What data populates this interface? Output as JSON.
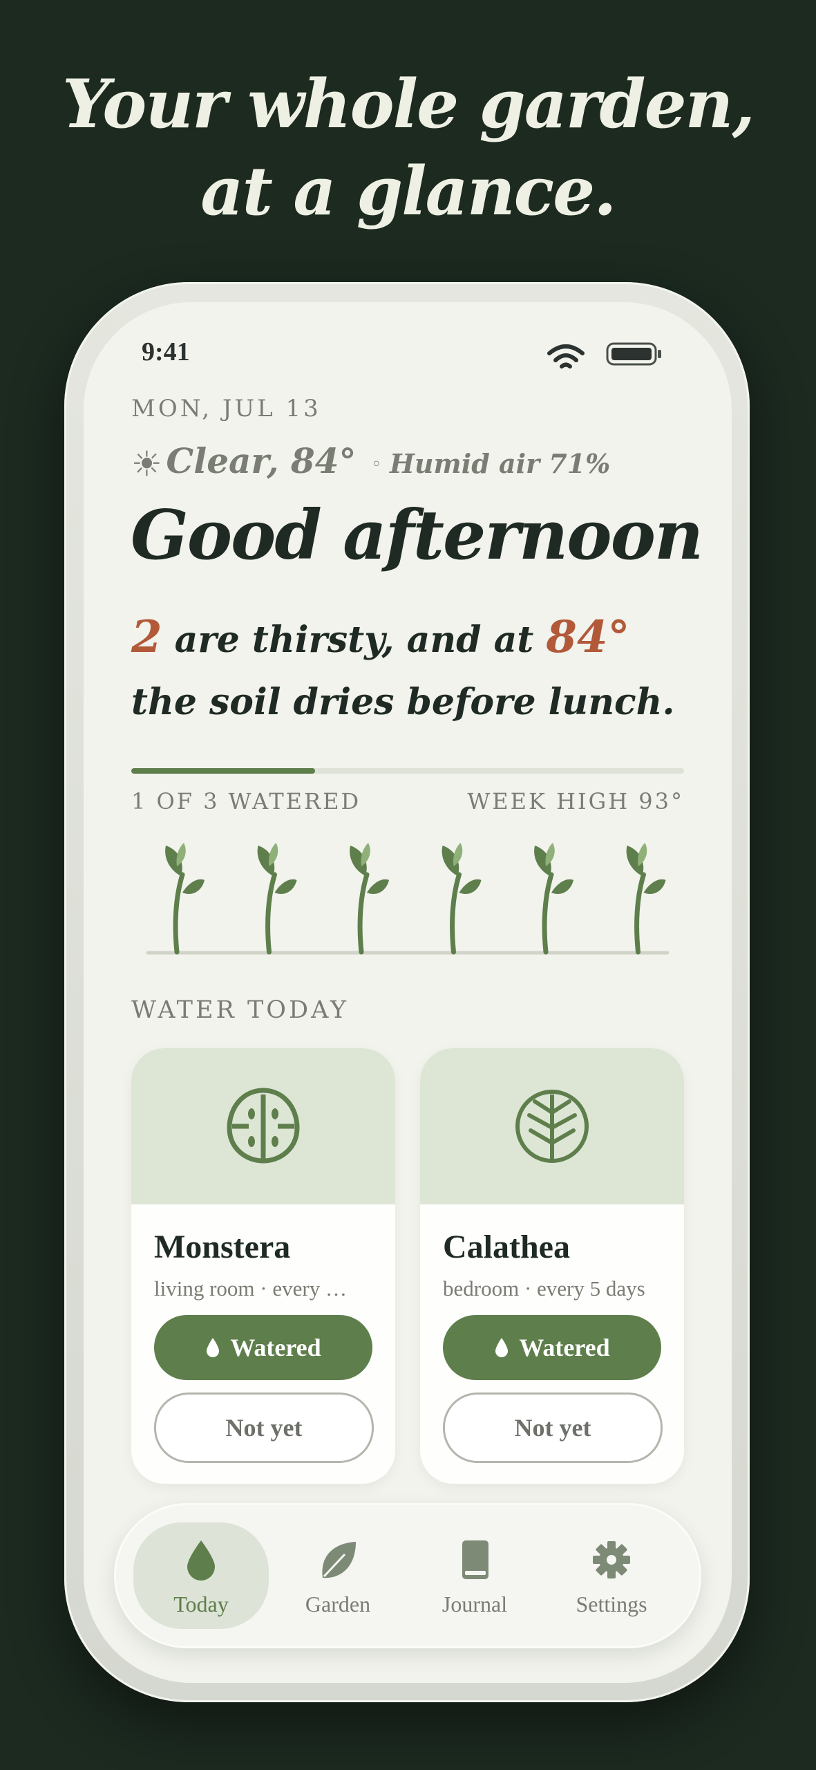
{
  "headline": {
    "line1": "Your whole garden,",
    "line2": "at a glance."
  },
  "status_bar": {
    "time": "9:41"
  },
  "header": {
    "date": "MON, JUL 13",
    "weather_icon": "sun-icon",
    "weather": "Clear, 84°",
    "humidity": "Humid air 71%",
    "greeting": "Good afternoon"
  },
  "summary": {
    "count": "2",
    "part1": " are thirsty, and at ",
    "temp": "84°",
    "part2": " the soil dries before lunch."
  },
  "progress": {
    "watered_label": "1 OF 3 WATERED",
    "week_high_label": "WEEK HIGH 93°",
    "fraction": 0.333
  },
  "sprouts": {
    "count": 6,
    "icon": "sprout-icon"
  },
  "water_today": {
    "label": "WATER TODAY",
    "plants": [
      {
        "name": "Monstera",
        "meta": "living room · every …",
        "icon": "monstera-leaf-icon",
        "watered_label": "Watered",
        "not_yet_label": "Not yet"
      },
      {
        "name": "Calathea",
        "meta": "bedroom · every 5 days",
        "icon": "calathea-leaf-icon",
        "watered_label": "Watered",
        "not_yet_label": "Not yet"
      }
    ]
  },
  "tabs": [
    {
      "label": "Today",
      "icon": "drop-icon",
      "active": true
    },
    {
      "label": "Garden",
      "icon": "leaf-icon",
      "active": false
    },
    {
      "label": "Journal",
      "icon": "book-icon",
      "active": false
    },
    {
      "label": "Settings",
      "icon": "gear-icon",
      "active": false
    }
  ],
  "colors": {
    "background": "#1c2a20",
    "screen": "#f1f3ec",
    "accent_green": "#5e7e4c",
    "accent_rust": "#b2593a",
    "muted_text": "#7a7d74"
  }
}
